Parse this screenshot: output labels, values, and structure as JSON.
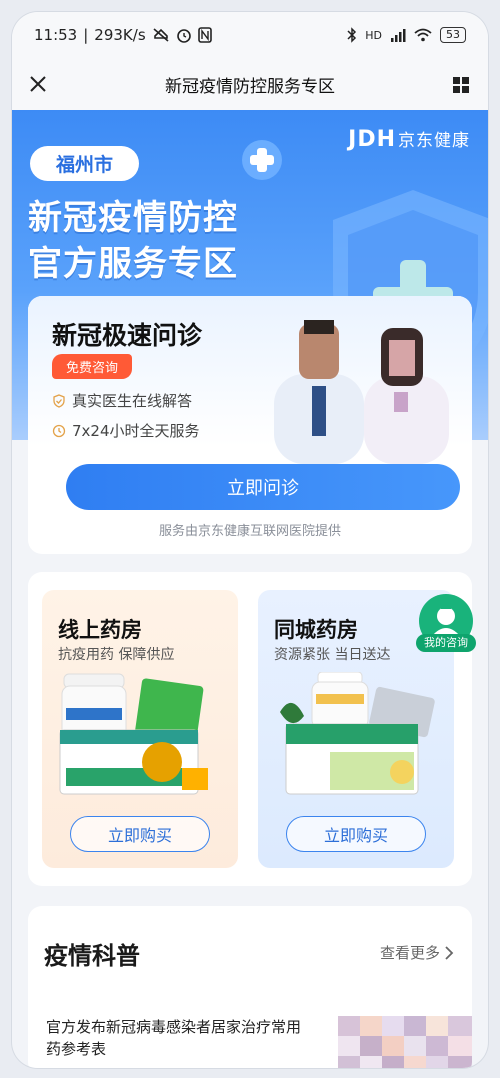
{
  "status_bar": {
    "time": "11:53",
    "speed": "293K/s",
    "network": "HD",
    "battery": "53"
  },
  "titlebar": {
    "title": "新冠疫情防控服务专区"
  },
  "hero": {
    "brand_latin": "JDH",
    "brand_cn": "京东健康",
    "city": "福州市",
    "line1": "新冠疫情防控",
    "line2": "官方服务专区"
  },
  "consult": {
    "title": "新冠极速问诊",
    "badge": "免费咨询",
    "features": [
      "真实医生在线解答",
      "7x24小时全天服务"
    ],
    "button": "立即问诊",
    "provider": "服务由京东健康互联网医院提供"
  },
  "pharmacy": {
    "online": {
      "title": "线上药房",
      "subtitle": "抗疫用药 保障供应",
      "button": "立即购买"
    },
    "city": {
      "title": "同城药房",
      "subtitle": "资源紧张 当日送达",
      "button": "立即购买"
    },
    "floating": {
      "label": "我的咨询"
    }
  },
  "science": {
    "title": "疫情科普",
    "more": "查看更多",
    "news_title": "官方发布新冠病毒感染者居家治疗常用药参考表"
  },
  "colors": {
    "primary": "#3b84ee",
    "badge": "#ff5a36",
    "float": "#19b37b"
  }
}
